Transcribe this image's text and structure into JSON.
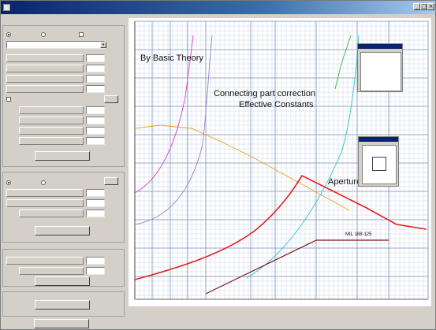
{
  "window": {
    "title": ""
  },
  "sidebar": {
    "group1_title": "",
    "group2_title": "",
    "group3_title": "",
    "group4_title": ""
  },
  "annotations": {
    "basic_theory": "By Basic Theory",
    "connecting_line1": "Connecting part correction",
    "connecting_line2": "Effective Constants",
    "aperture_fixed": "Aperture Fixed",
    "mil_spec": "MIL 188-125"
  }
}
